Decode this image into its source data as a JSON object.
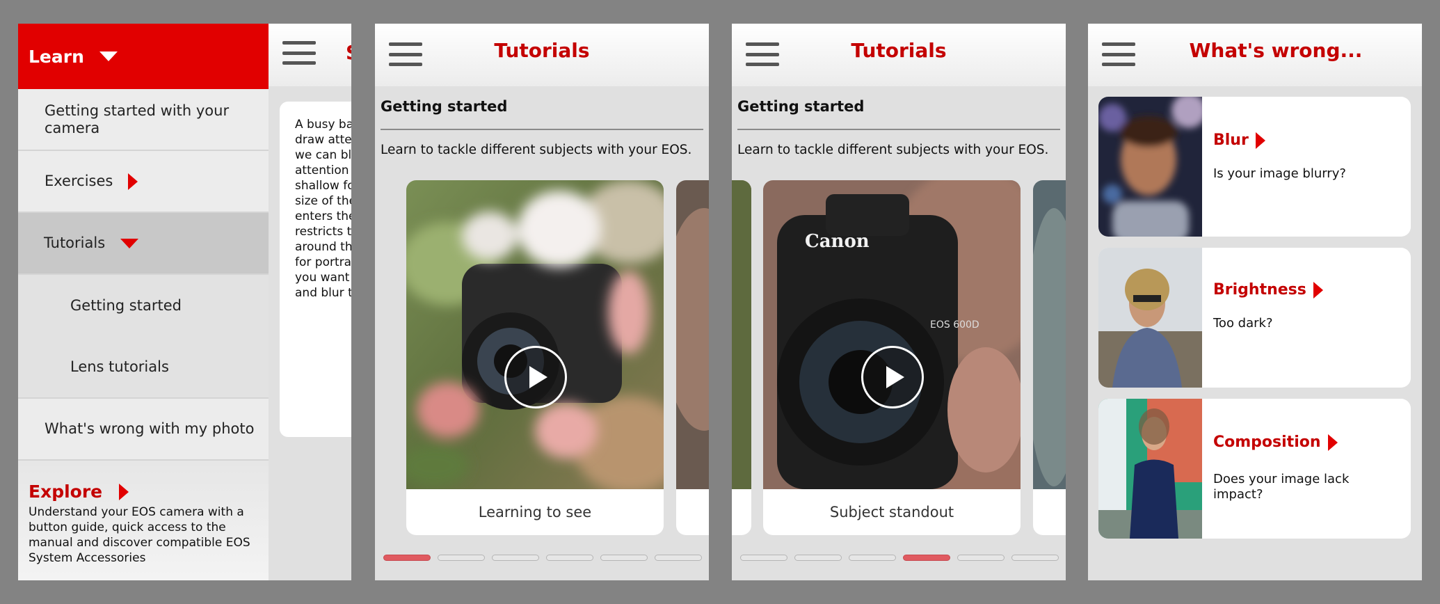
{
  "menu": {
    "header": "Learn",
    "items": [
      {
        "label": "Getting started with your camera"
      },
      {
        "label": "Exercises"
      },
      {
        "label": "Tutorials"
      },
      {
        "label": "Getting started"
      },
      {
        "label": "Lens tutorials"
      },
      {
        "label": "What's wrong with my photo"
      }
    ],
    "explore_title": "Explore",
    "explore_desc": "Understand your EOS camera with a button guide, quick access to the manual and discover compatible EOS System Accessories"
  },
  "behind": {
    "title_fragment": "S",
    "text": "A busy ba\ndraw atte\nwe can bl\nattention\nshallow fo\nsize of the\nenters the\nrestricts t\naround th\nfor portra\nyou want\nand blur t"
  },
  "tutorials_1": {
    "title": "Tutorials",
    "section": "Getting started",
    "desc": "Learn to tackle different subjects with your EOS.",
    "card_caption": "Learning to see",
    "active_dot": 0
  },
  "tutorials_2": {
    "title": "Tutorials",
    "section": "Getting started",
    "desc": "Learn to tackle different subjects with your EOS.",
    "card_caption": "Subject standout",
    "active_dot": 3
  },
  "camera_brand": "Canon",
  "camera_model": "EOS 600D",
  "whats_wrong": {
    "title": "What's wrong...",
    "cards": [
      {
        "title": "Blur",
        "desc": "Is your image blurry?"
      },
      {
        "title": "Brightness",
        "desc": "Too dark?"
      },
      {
        "title": "Composition",
        "desc": "Does your image lack impact?"
      }
    ]
  },
  "colors": {
    "brand_red": "#e10000",
    "title_red": "#c40000",
    "active_dot": "#e05a60"
  }
}
